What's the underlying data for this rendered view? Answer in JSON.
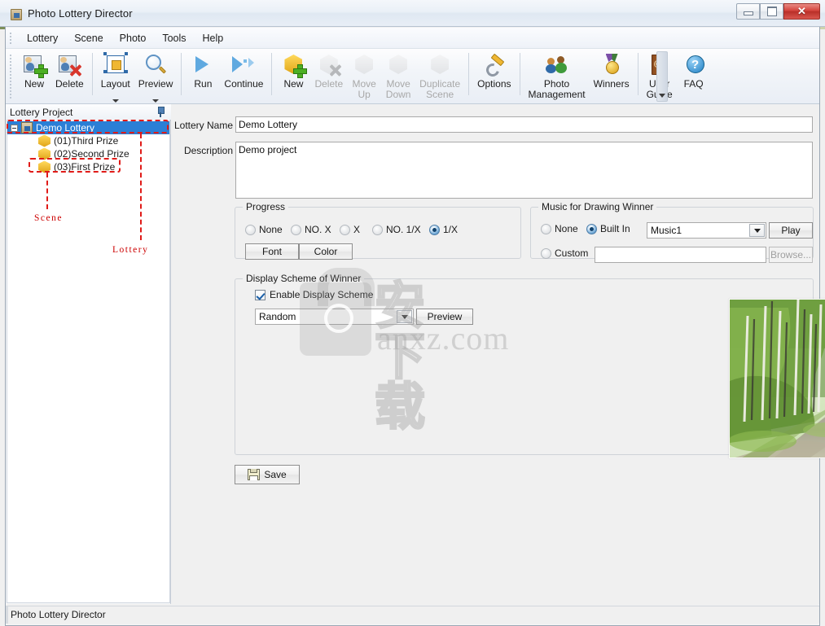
{
  "window": {
    "title": "Photo Lottery Director",
    "icon": "app-icon",
    "controls": {
      "minimize": "–",
      "maximize": "□",
      "close": "✕"
    }
  },
  "menubar": {
    "items": [
      {
        "label": "Lottery"
      },
      {
        "label": "Scene"
      },
      {
        "label": "Photo"
      },
      {
        "label": "Tools"
      },
      {
        "label": "Help"
      }
    ]
  },
  "toolbar": {
    "buttons": [
      {
        "label": "New",
        "icon": "new-photo-icon",
        "disabled": false,
        "dropdown": false
      },
      {
        "label": "Delete",
        "icon": "delete-photo-icon",
        "disabled": false,
        "dropdown": false
      },
      {
        "label": "Layout",
        "icon": "layout-icon",
        "disabled": false,
        "dropdown": true
      },
      {
        "label": "Preview",
        "icon": "magnifier-icon",
        "disabled": false,
        "dropdown": true
      },
      {
        "label": "Run",
        "icon": "play-icon",
        "disabled": false,
        "dropdown": false
      },
      {
        "label": "Continue",
        "icon": "play-forward-icon",
        "disabled": false,
        "dropdown": false
      },
      {
        "label": "New",
        "icon": "cube-new-icon",
        "disabled": false,
        "dropdown": false
      },
      {
        "label": "Delete",
        "icon": "cube-delete-icon",
        "disabled": true,
        "dropdown": false
      },
      {
        "label": "Move\nUp",
        "icon": "cube-move-up-icon",
        "disabled": true,
        "dropdown": false
      },
      {
        "label": "Move\nDown",
        "icon": "cube-move-down-icon",
        "disabled": true,
        "dropdown": false
      },
      {
        "label": "Duplicate\nScene",
        "icon": "cube-duplicate-icon",
        "disabled": true,
        "dropdown": false
      },
      {
        "label": "Options",
        "icon": "wrench-icon",
        "disabled": false,
        "dropdown": false
      },
      {
        "label": "Photo\nManagement",
        "icon": "people-icon",
        "disabled": false,
        "dropdown": false
      },
      {
        "label": "Winners",
        "icon": "medal-icon",
        "disabled": false,
        "dropdown": false
      },
      {
        "label": "User\nGuide",
        "icon": "book-icon",
        "disabled": false,
        "dropdown": false
      },
      {
        "label": "FAQ",
        "icon": "faq-icon",
        "disabled": false,
        "dropdown": false
      }
    ],
    "overflow_icon": "toolbar-overflow-chevron-icon"
  },
  "sidebar": {
    "title": "Lottery Project",
    "pin_icon": "pin-icon",
    "tree": {
      "root": {
        "label": "Demo Lottery",
        "icon": "lottery-project-icon",
        "selected": true,
        "expander": "collapse-icon"
      },
      "children": [
        {
          "label": "(01)Third Prize",
          "icon": "scene-hex-icon"
        },
        {
          "label": "(02)Second Prize",
          "icon": "scene-hex-icon"
        },
        {
          "label": "(03)First Prize",
          "icon": "scene-hex-icon"
        }
      ]
    },
    "annotations": [
      {
        "label": "Scene",
        "color": "#cc0000"
      },
      {
        "label": "Lottery",
        "color": "#cc0000"
      }
    ]
  },
  "main": {
    "lottery_name": {
      "label": "Lottery Name",
      "value": "Demo Lottery",
      "placeholder": ""
    },
    "description": {
      "label": "Description",
      "value": "Demo project",
      "placeholder": ""
    },
    "progress": {
      "title": "Progress",
      "options": [
        {
          "label": "None",
          "selected": false
        },
        {
          "label": "NO. X",
          "selected": false
        },
        {
          "label": "X",
          "selected": false
        },
        {
          "label": "NO. 1/X",
          "selected": false
        },
        {
          "label": "1/X",
          "selected": true
        }
      ],
      "font_button": "Font",
      "color_button": "Color"
    },
    "music": {
      "title": "Music for Drawing Winner",
      "none_label": "None",
      "none_selected": false,
      "builtin_label": "Built In",
      "builtin_selected": true,
      "builtin_value": "Music1",
      "play_button": "Play",
      "custom_label": "Custom",
      "custom_selected": false,
      "custom_value": "",
      "custom_placeholder": "",
      "browse_button": "Browse..."
    },
    "display_scheme": {
      "title": "Display Scheme of Winner",
      "enable_label": "Enable Display Scheme",
      "enable_checked": true,
      "scheme_value": "Random",
      "preview_button": "Preview",
      "photo_alt": "forest-road-photo"
    },
    "save_button": {
      "label": "Save",
      "icon": "floppy-disk-icon"
    }
  },
  "statusbar": {
    "text": "Photo Lottery Director"
  },
  "watermark": {
    "cjk": "安下载",
    "domain": "anxz.com",
    "lock_icon": "lock-watermark-icon"
  },
  "colors": {
    "accent": "#2b7fd6",
    "annotation": "#e01b18",
    "close_button": "#c0392b",
    "title_bar": "#eaf0f7"
  }
}
